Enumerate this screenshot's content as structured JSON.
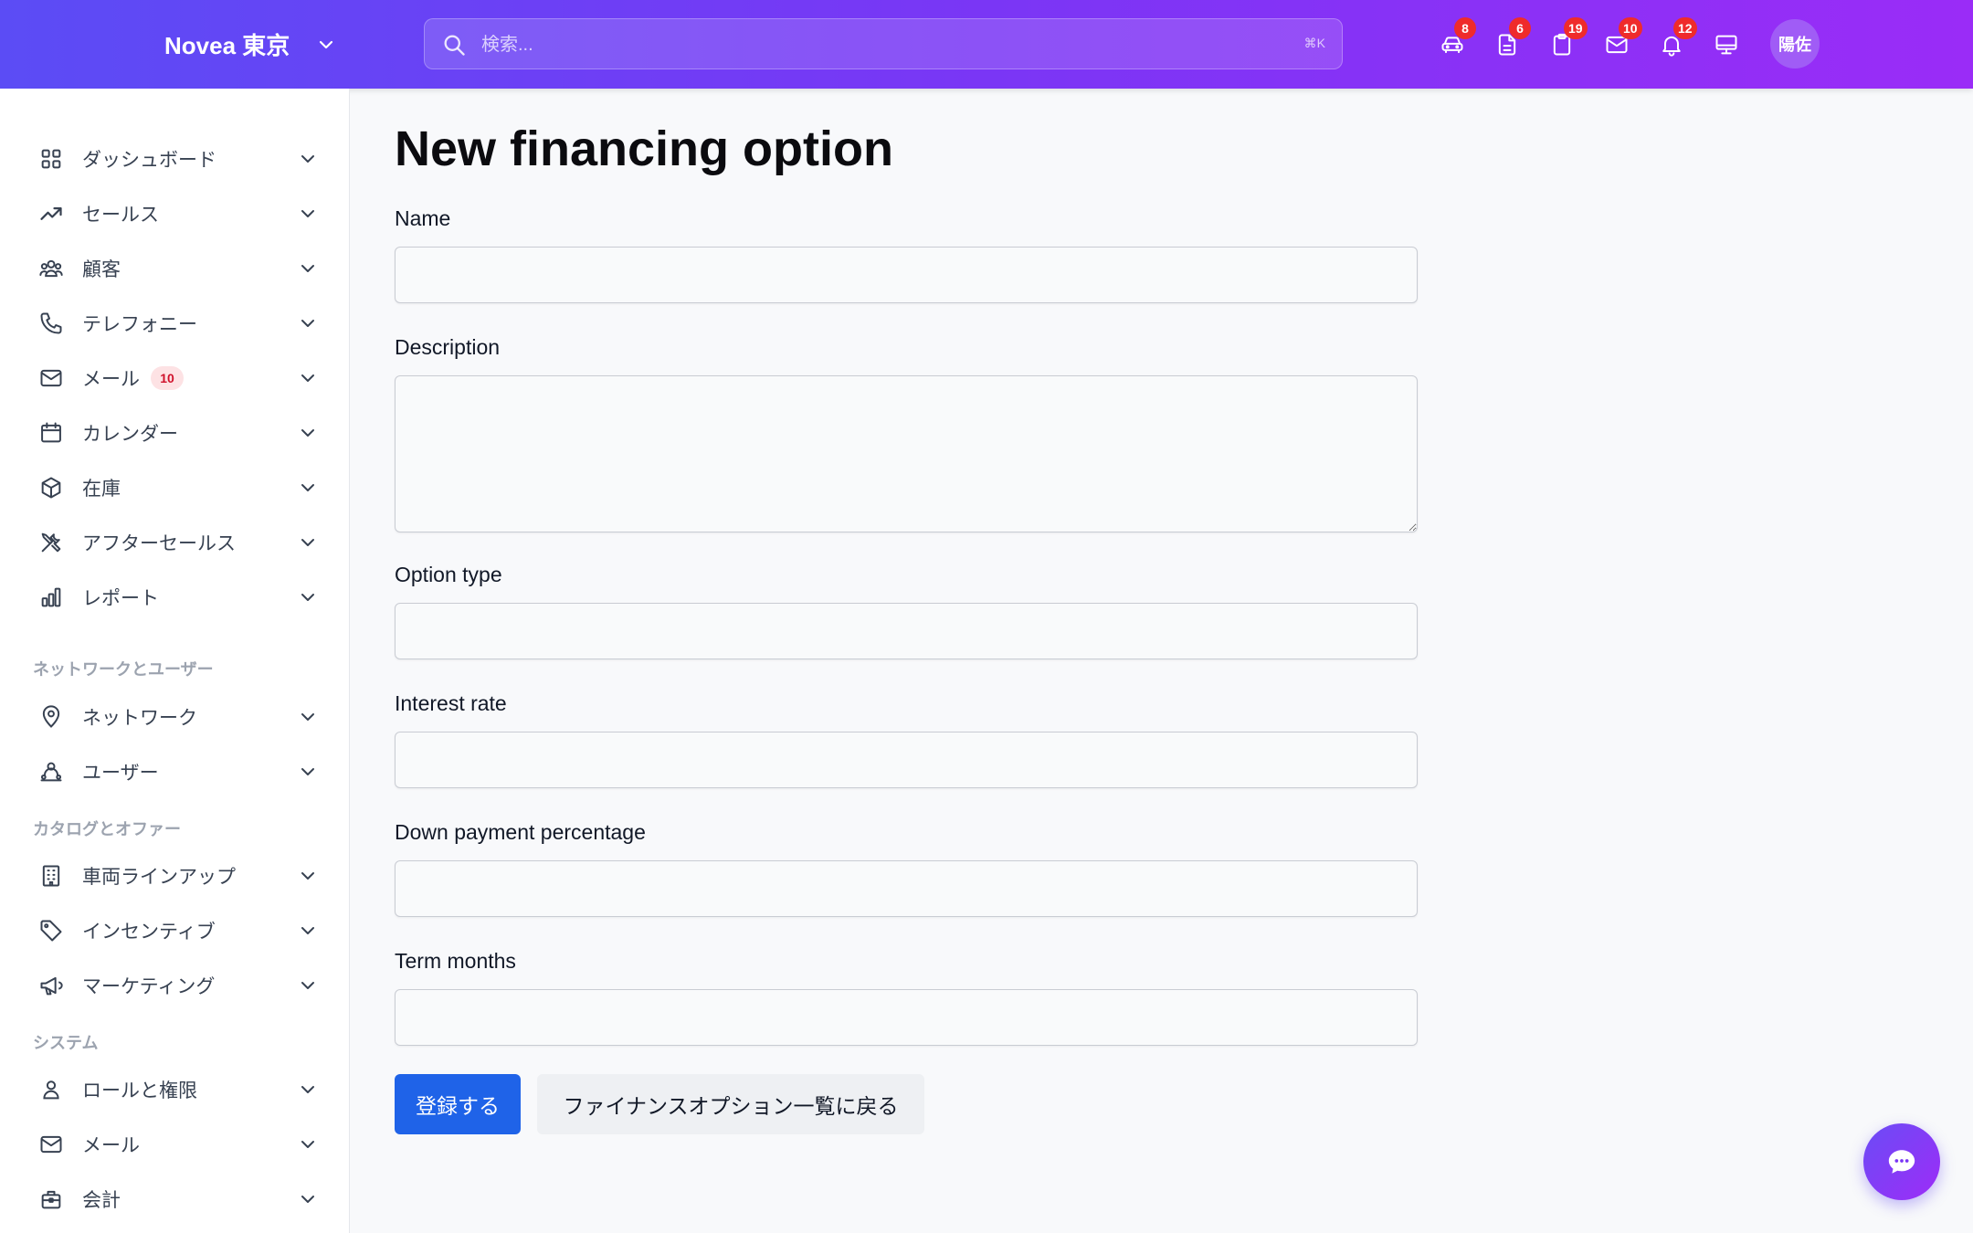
{
  "header": {
    "brand": "Novea 東京",
    "search_placeholder": "検索...",
    "search_shortcut": "⌘K",
    "icons": [
      {
        "icon": "car-icon",
        "badge": "8"
      },
      {
        "icon": "document-icon",
        "badge": "6"
      },
      {
        "icon": "clipboard-icon",
        "badge": "19"
      },
      {
        "icon": "mail-icon",
        "badge": "10"
      },
      {
        "icon": "bell-icon",
        "badge": "12"
      },
      {
        "icon": "monitor-icon",
        "badge": ""
      }
    ],
    "avatar": "陽佐"
  },
  "sidebar": {
    "items": [
      {
        "label": "ダッシュボード",
        "icon": "grid-icon"
      },
      {
        "label": "セールス",
        "icon": "trending-up-icon"
      },
      {
        "label": "顧客",
        "icon": "users-icon"
      },
      {
        "label": "テレフォニー",
        "icon": "phone-icon"
      },
      {
        "label": "メール",
        "icon": "mail-icon",
        "badge": "10"
      },
      {
        "label": "カレンダー",
        "icon": "calendar-icon"
      },
      {
        "label": "在庫",
        "icon": "cube-icon"
      },
      {
        "label": "アフターセールス",
        "icon": "tools-icon"
      },
      {
        "label": "レポート",
        "icon": "bar-chart-icon"
      }
    ],
    "sections": [
      {
        "title": "ネットワークとユーザー",
        "items": [
          {
            "label": "ネットワーク",
            "icon": "map-pin-icon"
          },
          {
            "label": "ユーザー",
            "icon": "user-group-icon"
          }
        ]
      },
      {
        "title": "カタログとオファー",
        "items": [
          {
            "label": "車両ラインアップ",
            "icon": "building-icon"
          },
          {
            "label": "インセンティブ",
            "icon": "tag-icon"
          },
          {
            "label": "マーケティング",
            "icon": "megaphone-icon"
          }
        ]
      },
      {
        "title": "システム",
        "items": [
          {
            "label": "ロールと権限",
            "icon": "user-icon"
          },
          {
            "label": "メール",
            "icon": "mail-icon"
          },
          {
            "label": "会計",
            "icon": "briefcase-icon"
          }
        ]
      }
    ]
  },
  "main": {
    "title": "New financing option",
    "fields": [
      {
        "label": "Name",
        "value": ""
      },
      {
        "label": "Description",
        "value": ""
      },
      {
        "label": "Option type",
        "value": ""
      },
      {
        "label": "Interest rate",
        "value": ""
      },
      {
        "label": "Down payment percentage",
        "value": ""
      },
      {
        "label": "Term months",
        "value": ""
      }
    ],
    "submit_label": "登録する",
    "back_label": "ファイナンスオプション一覧に戻る"
  },
  "colors": {
    "header_gradient_start": "#5b4cf5",
    "header_gradient_end": "#9a2cf7",
    "primary_button": "#1f63e8",
    "badge_red": "#ef2b2b"
  }
}
